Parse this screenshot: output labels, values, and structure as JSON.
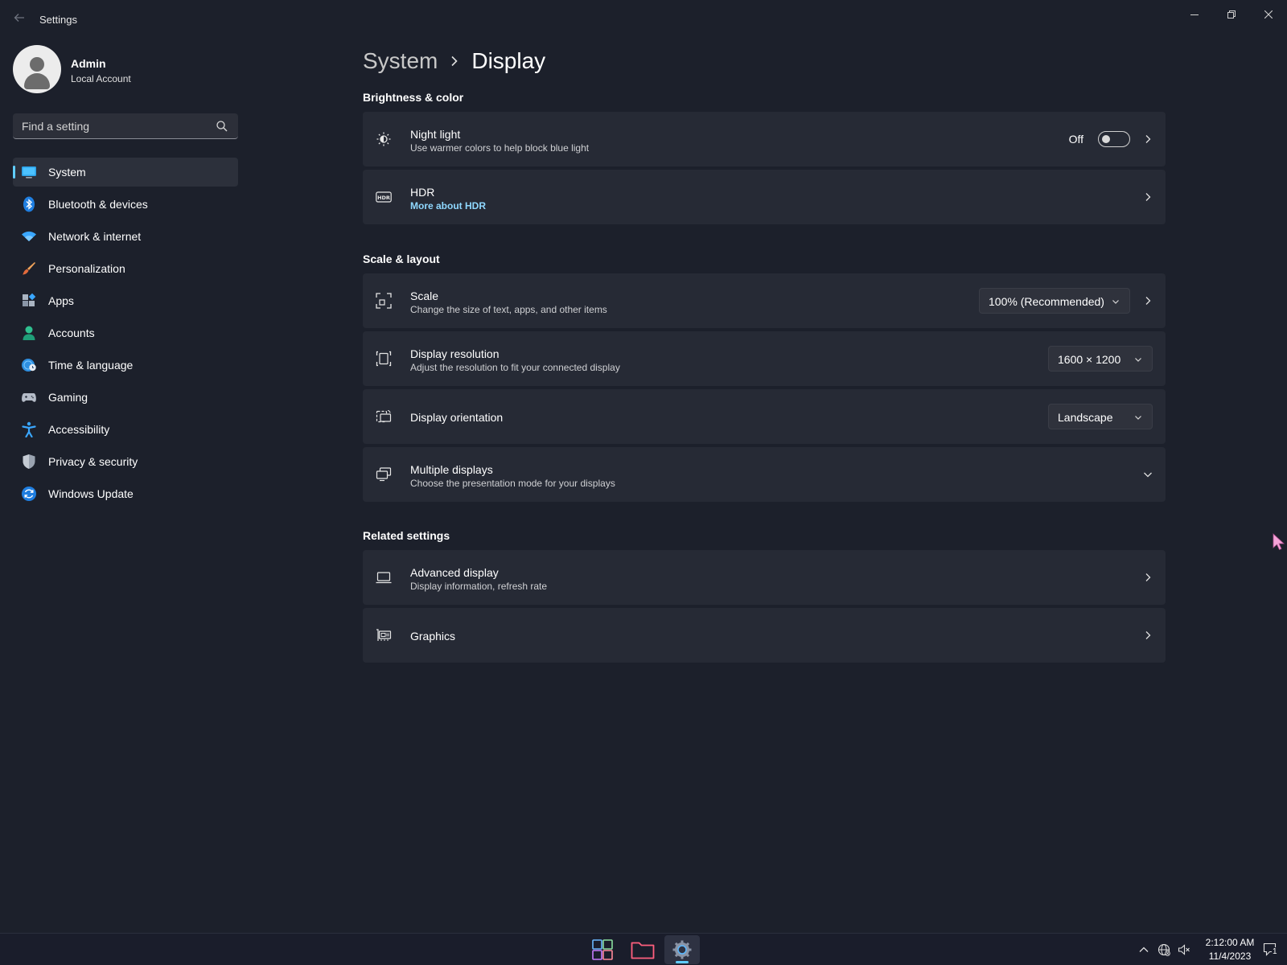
{
  "window": {
    "title": "Settings",
    "back_icon": "back-arrow-icon",
    "controls": [
      "minimize-icon",
      "restore-icon",
      "close-icon"
    ]
  },
  "user": {
    "name": "Admin",
    "account_type": "Local Account"
  },
  "search": {
    "placeholder": "Find a setting"
  },
  "sidebar": {
    "items": [
      {
        "label": "System",
        "icon": "monitor-icon",
        "active": true
      },
      {
        "label": "Bluetooth & devices",
        "icon": "bluetooth-icon"
      },
      {
        "label": "Network & internet",
        "icon": "wifi-icon"
      },
      {
        "label": "Personalization",
        "icon": "brush-icon"
      },
      {
        "label": "Apps",
        "icon": "apps-icon"
      },
      {
        "label": "Accounts",
        "icon": "person-icon"
      },
      {
        "label": "Time & language",
        "icon": "globe-clock-icon"
      },
      {
        "label": "Gaming",
        "icon": "gamepad-icon"
      },
      {
        "label": "Accessibility",
        "icon": "accessibility-icon"
      },
      {
        "label": "Privacy & security",
        "icon": "shield-icon"
      },
      {
        "label": "Windows Update",
        "icon": "update-icon"
      }
    ]
  },
  "breadcrumb": {
    "parent": "System",
    "current": "Display"
  },
  "sections": {
    "brightness": {
      "title": "Brightness & color",
      "night_light": {
        "title": "Night light",
        "subtitle": "Use warmer colors to help block blue light",
        "toggle_state": "Off"
      },
      "hdr": {
        "title": "HDR",
        "link": "More about HDR"
      }
    },
    "scale_layout": {
      "title": "Scale & layout",
      "scale": {
        "title": "Scale",
        "subtitle": "Change the size of text, apps, and other items",
        "value": "100% (Recommended)"
      },
      "resolution": {
        "title": "Display resolution",
        "subtitle": "Adjust the resolution to fit your connected display",
        "value": "1600 × 1200"
      },
      "orientation": {
        "title": "Display orientation",
        "value": "Landscape"
      },
      "multiple": {
        "title": "Multiple displays",
        "subtitle": "Choose the presentation mode for your displays"
      }
    },
    "related": {
      "title": "Related settings",
      "advanced": {
        "title": "Advanced display",
        "subtitle": "Display information, refresh rate"
      },
      "graphics": {
        "title": "Graphics"
      }
    }
  },
  "taskbar": {
    "apps": [
      "start-icon",
      "file-explorer-icon",
      "settings-gear-icon"
    ],
    "clock_time": "2:12:00 AM",
    "clock_date": "11/4/2023",
    "notification_count": "1"
  },
  "colors": {
    "accent": "#60cdff",
    "background": "#1c202b",
    "card": "#262a35"
  }
}
